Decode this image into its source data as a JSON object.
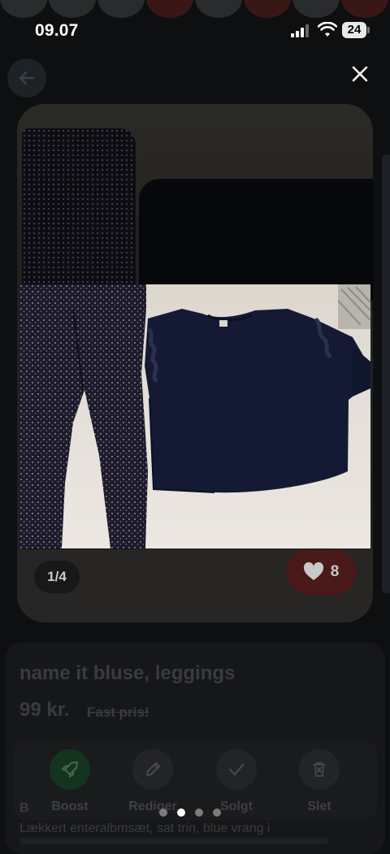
{
  "status_bar": {
    "time": "09.07",
    "battery": "24"
  },
  "listing": {
    "title": "name it bluse, leggings",
    "price": "99 kr.",
    "fixed_price_label": "Fast pris!",
    "image_counter": "1/4",
    "like_count": "8",
    "description_heading_letter": "B",
    "description_first_line": "Lækkert enteralbmsæt, sat trin, blue vrang i"
  },
  "actions": [
    {
      "label": "Boost",
      "icon": "rocket-icon"
    },
    {
      "label": "Rediger",
      "icon": "pencil-icon"
    },
    {
      "label": "Solgt",
      "icon": "check-icon"
    },
    {
      "label": "Slet",
      "icon": "trash-icon"
    }
  ],
  "gallery": {
    "page_count": 4,
    "active_index": 1
  },
  "colors": {
    "backdrop": "#0e0f10",
    "boost_green": "#143420",
    "like_red": "#4a1919",
    "active_dot": "#ffffff",
    "inactive_dot": "#7c7c7c"
  }
}
